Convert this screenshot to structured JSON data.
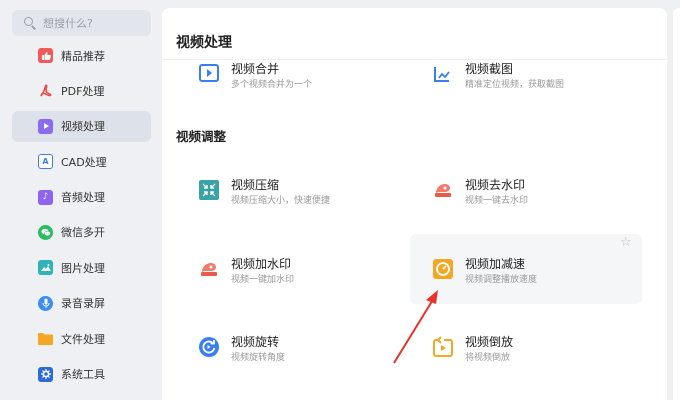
{
  "search": {
    "placeholder": "想搜什么?"
  },
  "sidebar": {
    "items": [
      {
        "label": "精品推荐",
        "icon": "thumbs-up-icon",
        "color": "#f25a5a"
      },
      {
        "label": "PDF处理",
        "icon": "pdf-icon",
        "color": "#ef4b4b"
      },
      {
        "label": "视频处理",
        "icon": "play-icon",
        "color": "#8b6cf0",
        "active": true
      },
      {
        "label": "CAD处理",
        "icon": "cad-icon",
        "color": "#3a7ef0"
      },
      {
        "label": "音频处理",
        "icon": "music-icon",
        "color": "#8d63ef"
      },
      {
        "label": "微信多开",
        "icon": "wechat-icon",
        "color": "#2bbd60"
      },
      {
        "label": "图片处理",
        "icon": "image-icon",
        "color": "#2fb3b8"
      },
      {
        "label": "录音录屏",
        "icon": "microphone-icon",
        "color": "#3c8cf5"
      },
      {
        "label": "文件处理",
        "icon": "folder-icon",
        "color": "#f5a623"
      },
      {
        "label": "系统工具",
        "icon": "gear-icon",
        "color": "#2d6bd8"
      }
    ]
  },
  "main": {
    "title": "视频处理",
    "cut_items": [
      {
        "name": "视频合并",
        "desc": "多个视频合并为一个"
      },
      {
        "name": "视频截图",
        "desc": "精准定位视频，获取截图"
      }
    ],
    "section_title": "视频调整",
    "tools": [
      {
        "name": "视频压缩",
        "desc": "视频压缩大小，快速便捷",
        "icon": "compress-icon"
      },
      {
        "name": "视频去水印",
        "desc": "视频一键去水印",
        "icon": "remove-watermark-icon"
      },
      {
        "name": "视频加水印",
        "desc": "视频一键加水印",
        "icon": "add-watermark-icon"
      },
      {
        "name": "视频加减速",
        "desc": "视频调整播放速度",
        "icon": "speed-icon"
      },
      {
        "name": "视频旋转",
        "desc": "视频旋转角度",
        "icon": "rotate-icon"
      },
      {
        "name": "视频倒放",
        "desc": "将视频倒放",
        "icon": "reverse-icon"
      }
    ]
  },
  "colors": {
    "accent": "#3aa3a8",
    "highlight_arrow": "#e8322a",
    "speed_icon": "#f5a623"
  }
}
